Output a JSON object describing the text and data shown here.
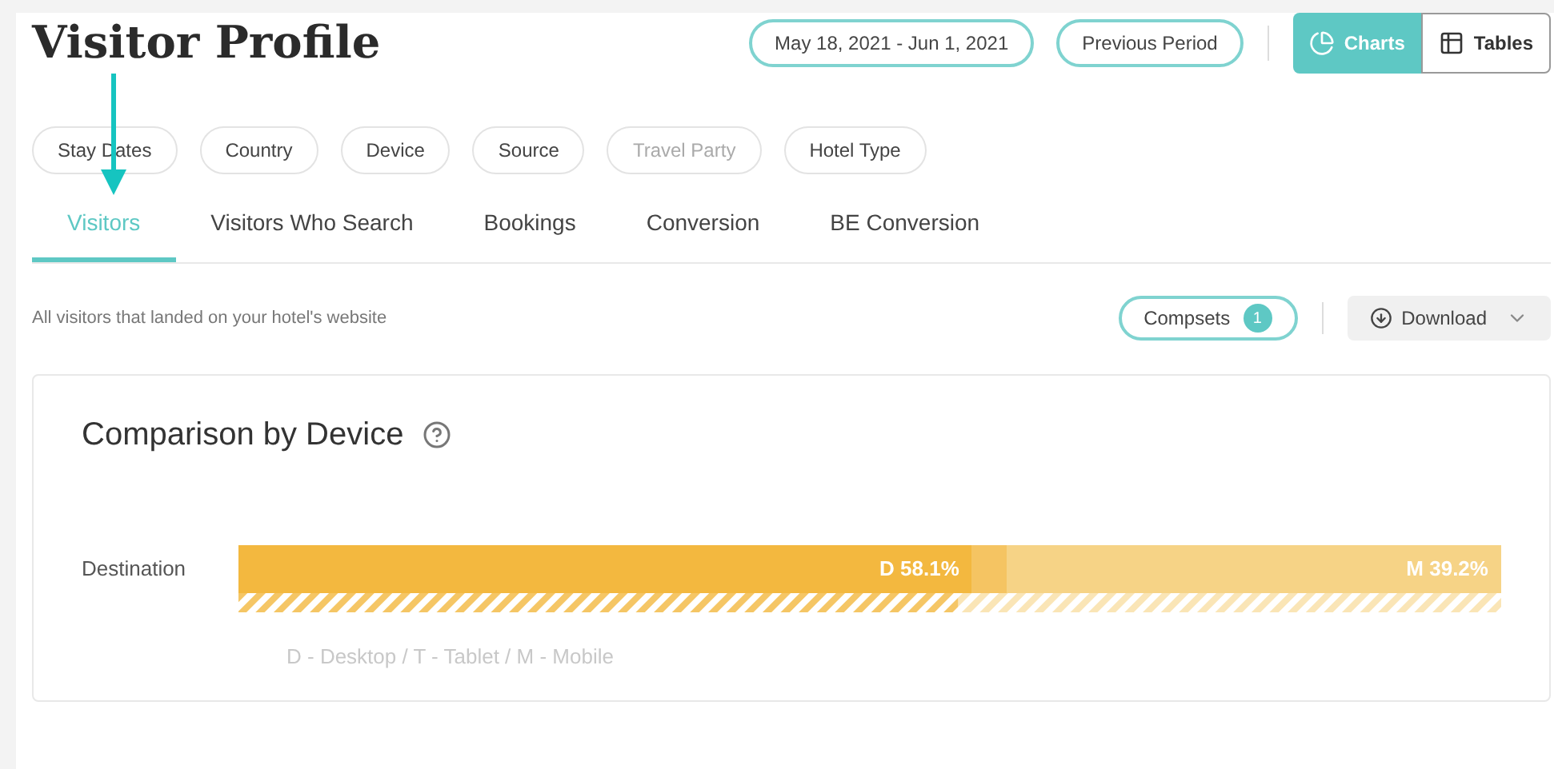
{
  "title": "Visitor Profile",
  "date_range": "May 18, 2021 - Jun 1, 2021",
  "compare_button": "Previous Period",
  "view_toggle": [
    {
      "label": "Charts",
      "kind": "charts",
      "selected": true
    },
    {
      "label": "Tables",
      "kind": "tables",
      "selected": false
    }
  ],
  "filters": [
    {
      "label": "Stay Dates",
      "disabled": false
    },
    {
      "label": "Country",
      "disabled": false
    },
    {
      "label": "Device",
      "disabled": false
    },
    {
      "label": "Source",
      "disabled": false
    },
    {
      "label": "Travel Party",
      "disabled": true
    },
    {
      "label": "Hotel Type",
      "disabled": false
    }
  ],
  "tabs": [
    {
      "label": "Visitors",
      "selected": true
    },
    {
      "label": "Visitors Who Search",
      "selected": false
    },
    {
      "label": "Bookings",
      "selected": false
    },
    {
      "label": "Conversion",
      "selected": false
    },
    {
      "label": "BE Conversion",
      "selected": false
    }
  ],
  "description": "All visitors that landed on your hotel's website",
  "compsets_button": {
    "label": "Compsets",
    "count": "1"
  },
  "download_button": "Download",
  "card": {
    "title": "Comparison by Device",
    "category": "Destination",
    "segments": [
      {
        "kind": "desktop",
        "label": "D 58.1%"
      },
      {
        "kind": "tablet"
      },
      {
        "kind": "mobile",
        "label": "M 39.2%"
      }
    ],
    "legend": "D - Desktop / T - Tablet / M - Mobile"
  }
}
